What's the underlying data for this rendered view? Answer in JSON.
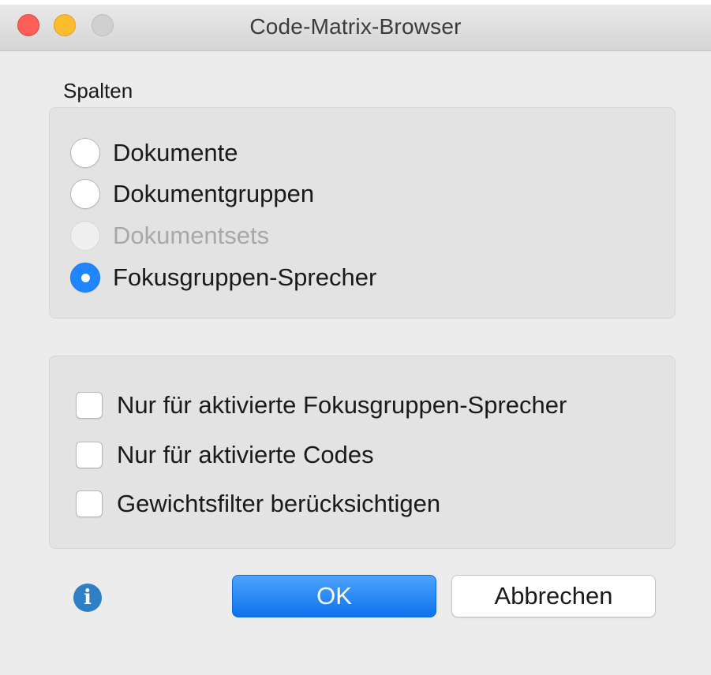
{
  "window": {
    "title": "Code-Matrix-Browser"
  },
  "columns": {
    "label": "Spalten",
    "options": [
      {
        "label": "Dokumente",
        "selected": false,
        "enabled": true
      },
      {
        "label": "Dokumentgruppen",
        "selected": false,
        "enabled": true
      },
      {
        "label": "Dokumentsets",
        "selected": false,
        "enabled": false
      },
      {
        "label": "Fokusgruppen-Sprecher",
        "selected": true,
        "enabled": true
      }
    ]
  },
  "filters": [
    {
      "label": "Nur für aktivierte Fokusgruppen-Sprecher",
      "checked": false
    },
    {
      "label": "Nur für aktivierte Codes",
      "checked": false
    },
    {
      "label": "Gewichtsfilter berücksichtigen",
      "checked": false
    }
  ],
  "buttons": {
    "ok": "OK",
    "cancel": "Abbrechen"
  },
  "icons": {
    "info": "info-icon",
    "info_glyph": "i"
  },
  "colors": {
    "accent": "#1f86ff",
    "close": "#fd5e56",
    "minimize": "#fdbc2e",
    "info": "#2f7fc4"
  }
}
